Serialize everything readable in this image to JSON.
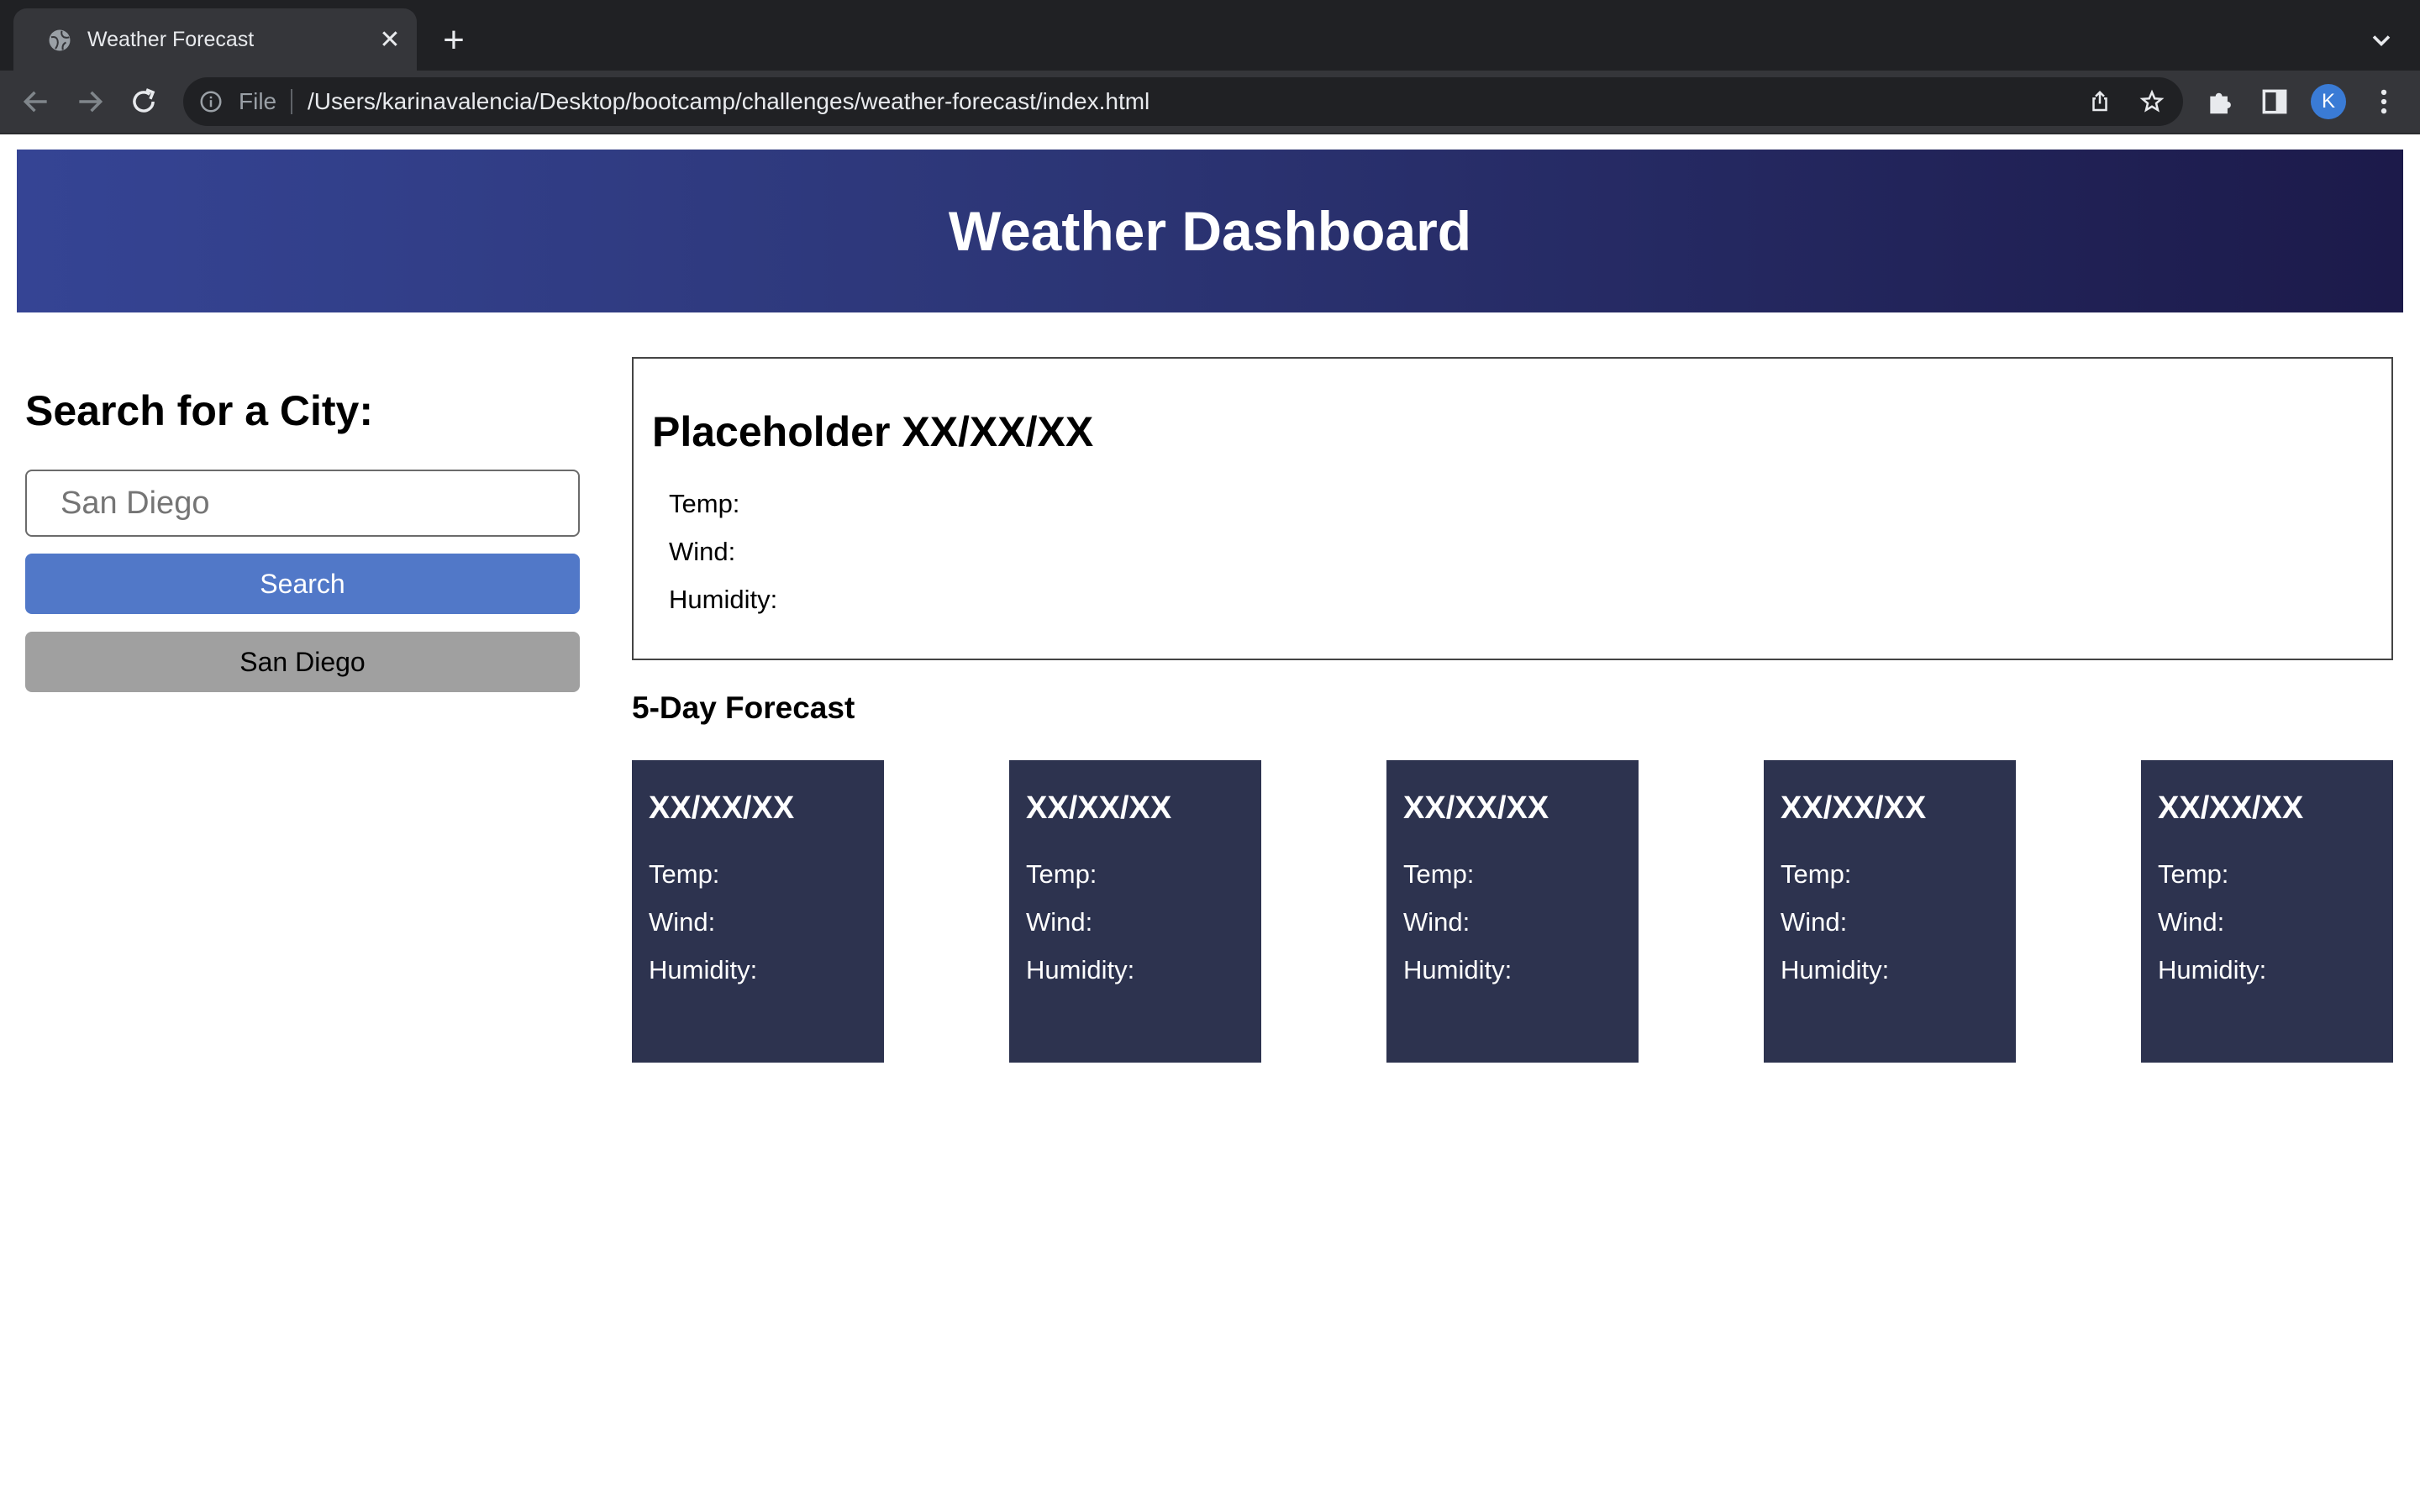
{
  "browser": {
    "tab_title": "Weather Forecast",
    "omnibox_scheme": "File",
    "url": "/Users/karinavalencia/Desktop/bootcamp/challenges/weather-forecast/index.html",
    "avatar_initial": "K"
  },
  "header": {
    "title": "Weather Dashboard"
  },
  "sidebar": {
    "title": "Search for a City:",
    "input_placeholder": "San Diego",
    "search_label": "Search",
    "history": [
      "San Diego"
    ]
  },
  "current": {
    "title": "Placeholder XX/XX/XX",
    "temp_label": "Temp:",
    "wind_label": "Wind:",
    "humidity_label": "Humidity:"
  },
  "forecast": {
    "title": "5-Day Forecast",
    "days": [
      {
        "date": "XX/XX/XX",
        "temp": "Temp:",
        "wind": "Wind:",
        "humidity": "Humidity:"
      },
      {
        "date": "XX/XX/XX",
        "temp": "Temp:",
        "wind": "Wind:",
        "humidity": "Humidity:"
      },
      {
        "date": "XX/XX/XX",
        "temp": "Temp:",
        "wind": "Wind:",
        "humidity": "Humidity:"
      },
      {
        "date": "XX/XX/XX",
        "temp": "Temp:",
        "wind": "Wind:",
        "humidity": "Humidity:"
      },
      {
        "date": "XX/XX/XX",
        "temp": "Temp:",
        "wind": "Wind:",
        "humidity": "Humidity:"
      }
    ]
  },
  "colors": {
    "header_start": "#354494",
    "header_end": "#1c1a4a",
    "search_button": "#5178c8",
    "history_button": "#a0a0a0",
    "card_bg": "#2d334f"
  },
  "icons": [
    "globe-icon",
    "close-icon",
    "plus-icon",
    "chevron-down-icon",
    "back-icon",
    "forward-icon",
    "reload-icon",
    "info-icon",
    "share-icon",
    "star-icon",
    "puzzle-icon",
    "side-panel-icon",
    "kebab-menu-icon"
  ]
}
